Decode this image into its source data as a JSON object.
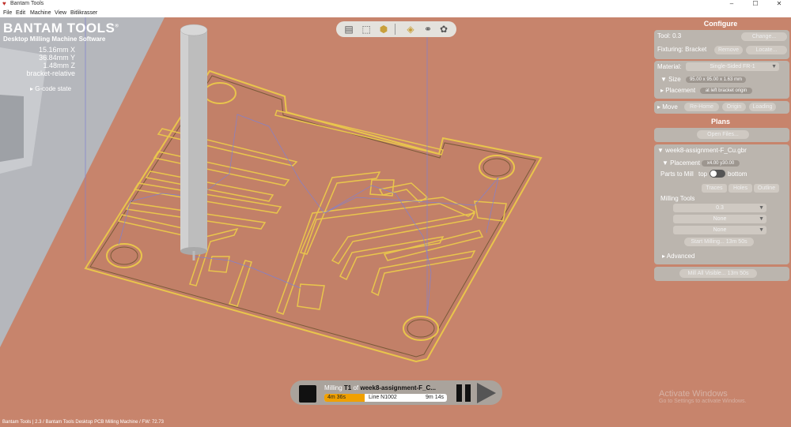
{
  "window": {
    "title": "Bantam Tools",
    "minimize": "–",
    "maximize": "☐",
    "close": "✕"
  },
  "menu": [
    "File",
    "Edit",
    "Machine",
    "View",
    "Bitlikrasser"
  ],
  "brand": {
    "title": "BANTAM TOOLS",
    "registered": "®",
    "subtitle": "Desktop Milling Machine Software"
  },
  "coords": {
    "x": "15.16mm X",
    "y": "36.84mm Y",
    "z": "1.48mm Z",
    "mode": "bracket-relative",
    "gcode": "G-code state"
  },
  "view_tools": [
    "book-icon",
    "frame-icon",
    "cube-icon",
    "board-icon",
    "circles-icon",
    "palette-icon"
  ],
  "configure": {
    "title": "Configure",
    "tool_label": "Tool: 0.3",
    "change": "Change...",
    "fixturing_label": "Fixturing: Bracket",
    "remove": "Remove",
    "locate": "Locate...",
    "material_label": "Material:",
    "material_value": "Single-Sided FR-1",
    "size_label": "Size",
    "size_value": "95.00 x 95.00 x 1.63 mm",
    "placement_label": "Placement",
    "placement_value": "at left bracket origin",
    "move_label": "Move",
    "rehome": "Re-Home",
    "origin": "Origin",
    "loading": "Loading"
  },
  "plans": {
    "title": "Plans",
    "open_files": "Open Files...",
    "file": "week8-assignment-F_Cu.gbr",
    "placement_label": "Placement",
    "placement_value": "x4.00 y30.00",
    "parts_label": "Parts to Mill",
    "top": "top",
    "bottom": "bottom",
    "traces": "Traces",
    "holes": "Holes",
    "outline": "Outline",
    "milling_tools_label": "Milling Tools",
    "tools": [
      "0.3",
      "None",
      "None"
    ],
    "start": "Start Milling... 13m 50s",
    "advanced": "Advanced",
    "mill_all": "Mill All Visible... 13m 50s"
  },
  "player": {
    "prefix": "Milling ",
    "tool": "T1",
    "of": " of ",
    "file": "week8-assignment-F_C...",
    "elapsed": "4m 36s",
    "line": "Line N1002",
    "remaining": "9m 14s",
    "progress": 0.33
  },
  "activate": {
    "line1": "Activate Windows",
    "line2": "Go to Settings to activate Windows."
  },
  "status": "Bantam Tools | 2.3 / Bantam Tools Desktop PCB Milling Machine / FW: 72.73",
  "colors": {
    "accent": "#c8a03c",
    "background": "#c7846c",
    "progress": "#f0a000",
    "trace": "#c8a03c"
  }
}
